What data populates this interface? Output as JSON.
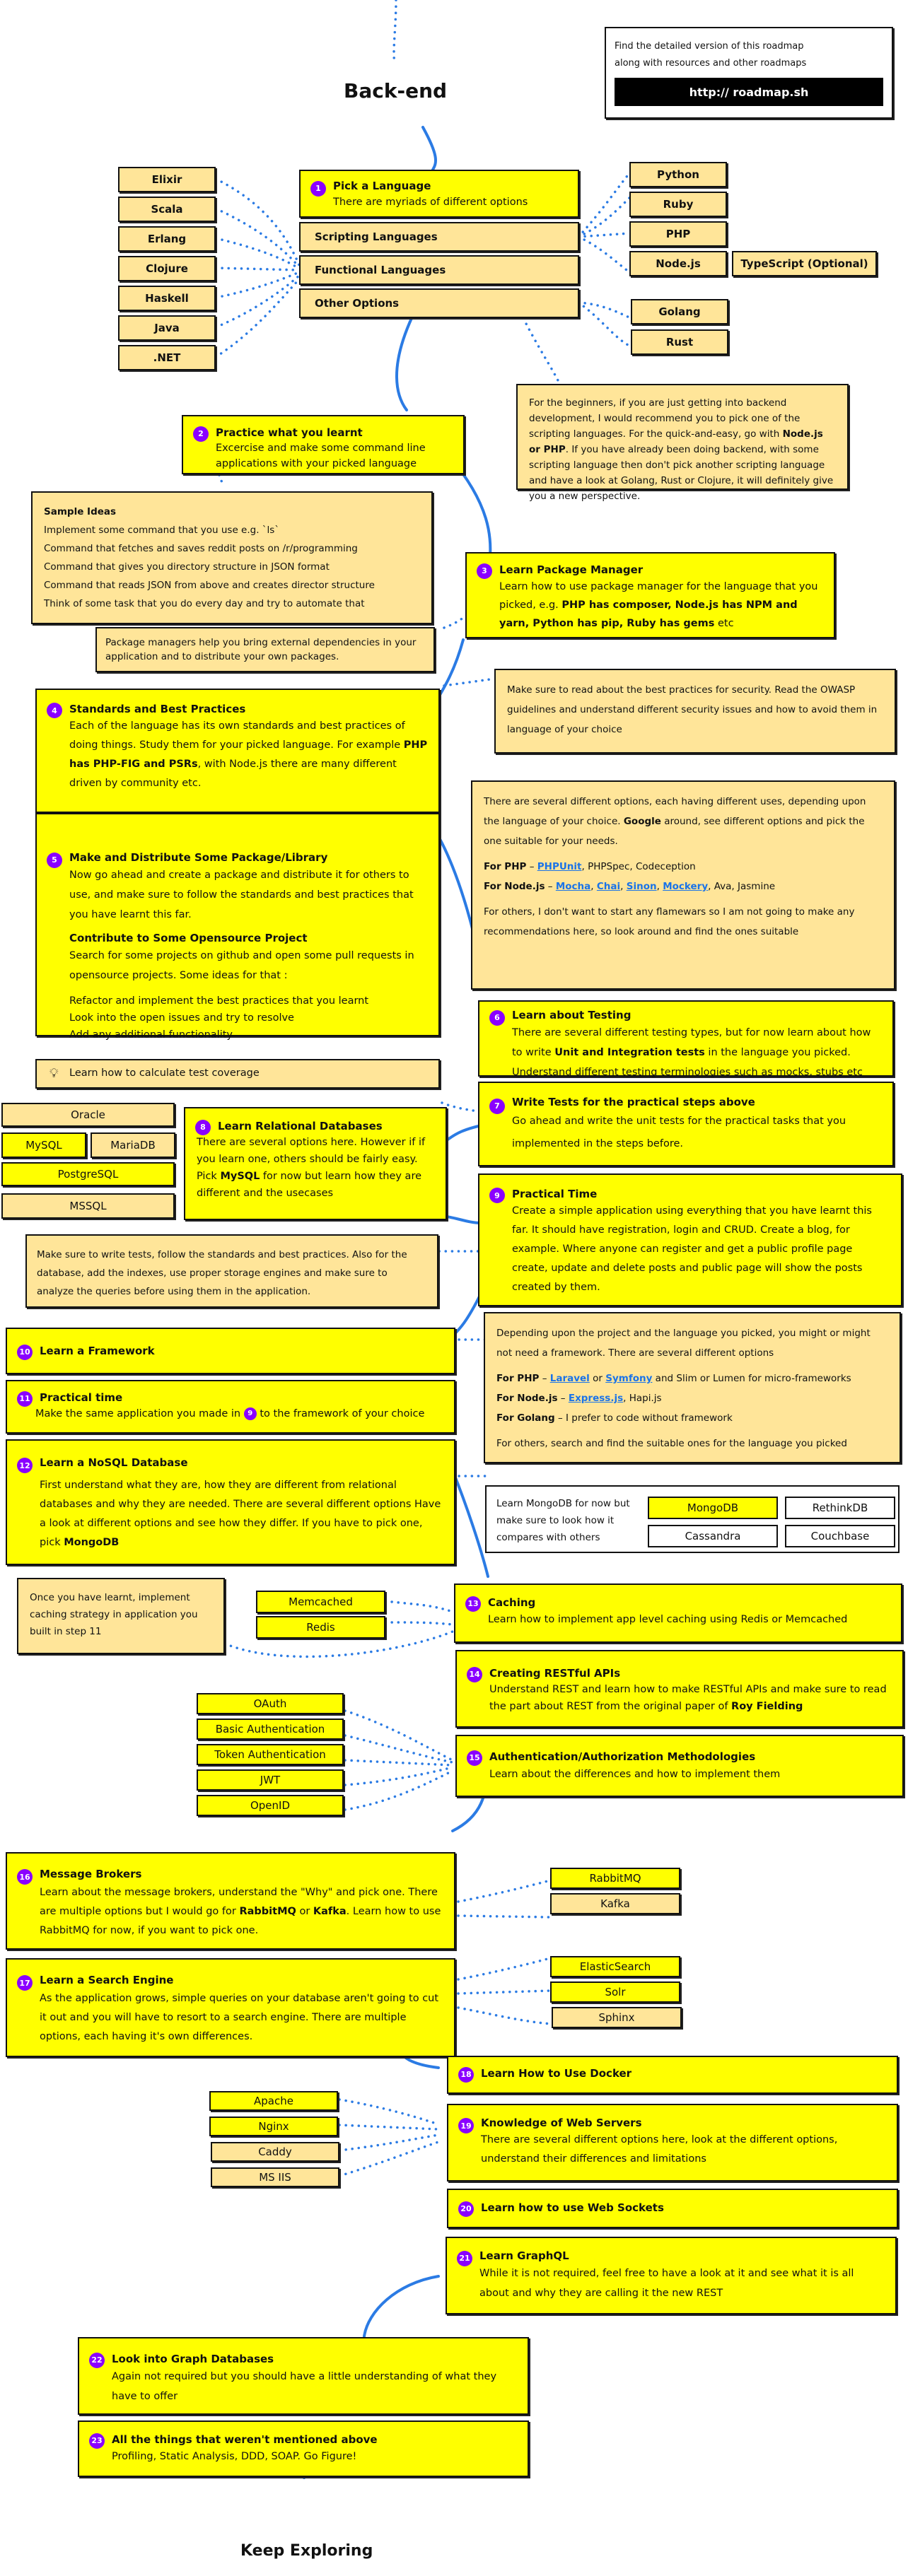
{
  "title": "Back-end",
  "footer_title": "Keep Exploring",
  "info_box": {
    "text_line1": "Find the detailed version of this roadmap",
    "text_line2": "along with resources and other roadmaps",
    "link_label": "http:// roadmap.sh"
  },
  "colors": {
    "primary": "#ffff00",
    "secondary": "#ffe599",
    "connector": "#2b7be4",
    "badge": "#8a00ff"
  },
  "step1": {
    "num": "1",
    "title": "Pick a Language",
    "desc": "There are myriads of different options",
    "categories": [
      "Scripting Languages",
      "Functional Languages",
      "Other Options"
    ],
    "functional": [
      "Elixir",
      "Scala",
      "Erlang",
      "Clojure",
      "Haskell",
      "Java",
      ".NET"
    ],
    "scripting": [
      "Python",
      "Ruby",
      "PHP",
      "Node.js"
    ],
    "scripting_extra": "TypeScript (Optional)",
    "other": [
      "Golang",
      "Rust"
    ],
    "note": {
      "p1": "For the beginners, if you are just getting into backend development, I would recommend you to pick one of the scripting languages. For the quick-and-easy, go with ",
      "b1": "Node.js or PHP",
      "p2": ". If you have already been doing backend, with some scripting language then don't pick another scripting language and have a look at Golang, Rust or Clojure, it will definitely give you a new perspective."
    }
  },
  "step2": {
    "num": "2",
    "title": "Practice what you learnt",
    "desc": "Excercise and make some command line applications with your picked language",
    "ideas_title": "Sample Ideas",
    "ideas": [
      "Implement some command that you use e.g. `ls`",
      "Command that fetches and saves reddit posts on /r/programming",
      "Command that gives you directory structure in JSON format",
      "Command that reads JSON from above and creates director structure",
      "Think of some task that you do every day and try to automate that"
    ]
  },
  "step3": {
    "num": "3",
    "title": "Learn Package Manager",
    "p1": "Learn how to use package manager for the language that you picked, e.g. ",
    "b1": "PHP has composer, Node.js has NPM and yarn, Python has pip, Ruby has gems",
    "p2": " etc",
    "note": "Package managers help you bring external dependencies in your application and to distribute your own packages."
  },
  "step4": {
    "num": "4",
    "title": "Standards and Best Practices",
    "p1": "Each of the language has its own standards and best practices of doing things. Study them for your picked language. For example ",
    "b1": "PHP has PHP-FIG and PSRs",
    "p2": ", with Node.js there are many different driven by community etc.",
    "note": "Make sure to read about the best practices for security. Read the OWASP guidelines and understand different security issues and how to avoid them in language of your choice"
  },
  "step5": {
    "num": "5",
    "title": "Make and Distribute Some Package/Library",
    "desc": "Now go ahead and create a package and distribute it for others to use, and make sure to follow the standards and best practices that you have learnt this far.",
    "sub_title": "Contribute to Some Opensource Project",
    "sub_desc": "Search for some projects on github and open some pull requests in opensource projects. Some ideas for that :",
    "ideas": [
      "Refactor and implement the best practices that you learnt",
      "Look into the open issues and try to resolve",
      "Add any additional functionality"
    ]
  },
  "testing_note": {
    "p1": "There are several different options, each having different uses, depending upon the language of your choice. ",
    "b1": "Google",
    "p2": " around, see different options and pick the one suitable for your needs.",
    "php_label": "For PHP",
    "php_links": [
      "PHPUnit"
    ],
    "php_rest": ", PHPSpec, Codeception",
    "node_label": "For Node.js",
    "node_links": [
      "Mocha",
      "Chai",
      "Sinon",
      "Mockery"
    ],
    "node_rest": ", Ava, Jasmine",
    "others": "For others, I don't want to start any flamewars so I am not going to make any recommendations here, so look around and find the ones suitable"
  },
  "step6": {
    "num": "6",
    "title": "Learn about Testing",
    "p1": "There are several different testing types, but for now learn about how to write ",
    "b1": "Unit and Integration tests",
    "p2": " in the language you picked. Understand different testing terminologies such as mocks, stubs etc"
  },
  "coverage_tip": "Learn how to calculate test coverage",
  "step7": {
    "num": "7",
    "title": "Write Tests for the practical steps above",
    "desc": "Go ahead and write the unit tests for the practical tasks that you implemented in the steps before."
  },
  "step8": {
    "num": "8",
    "title": "Learn Relational Databases",
    "p1": "There are several options here. However if if you learn one, others should be fairly easy. Pick ",
    "b1": "MySQL",
    "p2": " for now but learn how they are different and the usecases",
    "databases": {
      "oracle": "Oracle",
      "mysql": "MySQL",
      "mariadb": "MariaDB",
      "postgresql": "PostgreSQL",
      "mssql": "MSSQL"
    },
    "note": "Make sure to write tests, follow the standards and best practices. Also for the database, add the indexes, use proper storage engines and make sure to analyze the queries before using them in the application."
  },
  "step9": {
    "num": "9",
    "title": "Practical Time",
    "desc": "Create a simple application using everything that you have learnt this far. It should have registration, login and CRUD. Create a blog, for example. Where anyone can register and get a public profile page create, update and delete posts and public page will show the posts created by them."
  },
  "step10": {
    "num": "10",
    "title": "Learn a Framework",
    "note": {
      "intro": "Depending upon the project and the language you picked, you might or might not need a framework. There are several different options",
      "php_label": "For PHP",
      "php_link1": "Laravel",
      "php_mid": " or ",
      "php_link2": "Symfony",
      "php_rest": " and Slim or Lumen for micro-frameworks",
      "node_label": "For Node.js",
      "node_link": "Express.js",
      "node_rest": ", Hapi.js",
      "go_label": "For Golang",
      "go_rest": " I prefer to code without framework",
      "others": "For others, search and find the suitable ones for the language you picked"
    }
  },
  "step11": {
    "num": "11",
    "title": "Practical time",
    "desc_a": "Make the same application you made in ",
    "ref": "9",
    "desc_b": " to the framework of your choice"
  },
  "step12": {
    "num": "12",
    "title": "Learn a NoSQL Database",
    "p1": "First understand what they are, how they are different from relational databases and why they are needed. There are several different options Have a look at different options and see how they differ. If you have to pick one, pick ",
    "b1": "MongoDB",
    "aside": "Learn MongoDB for now but make sure to look how it compares with others",
    "options": [
      "MongoDB",
      "RethinkDB",
      "Cassandra",
      "Couchbase"
    ]
  },
  "step13": {
    "num": "13",
    "title": "Caching",
    "desc": "Learn how to implement app level caching using Redis or Memcached",
    "options": [
      "Memcached",
      "Redis"
    ],
    "note": "Once you have learnt, implement caching strategy in application you built in step 11"
  },
  "step14": {
    "num": "14",
    "title": "Creating RESTful APIs",
    "p1": "Understand REST and learn how to make RESTful APIs and make sure to read the part about REST from the original paper of ",
    "b1": "Roy Fielding"
  },
  "step15": {
    "num": "15",
    "title": "Authentication/Authorization Methodologies",
    "desc": "Learn about the differences and how to implement them",
    "options": [
      "OAuth",
      "Basic Authentication",
      "Token Authentication",
      "JWT",
      "OpenID"
    ]
  },
  "step16": {
    "num": "16",
    "title": "Message Brokers",
    "p1": "Learn about the message brokers, understand the \"Why\" and pick one. There are multiple options but I would go for ",
    "b1": "RabbitMQ",
    "mid": " or ",
    "b2": "Kafka",
    "p2": ". Learn how to use RabbitMQ for now, if you want to pick one.",
    "options": [
      "RabbitMQ",
      "Kafka"
    ]
  },
  "step17": {
    "num": "17",
    "title": "Learn a Search Engine",
    "desc": "As the application grows, simple queries on your database aren't going to cut it out and you will have to resort to a search engine. There are multiple options, each having it's own differences.",
    "options": [
      "ElasticSearch",
      "Solr",
      "Sphinx"
    ]
  },
  "step18": {
    "num": "18",
    "title": "Learn How to Use Docker"
  },
  "step19": {
    "num": "19",
    "title": "Knowledge of Web Servers",
    "desc": "There are several different options here, look at the different options, understand their differences and limitations",
    "options": [
      "Apache",
      "Nginx",
      "Caddy",
      "MS IIS"
    ]
  },
  "step20": {
    "num": "20",
    "title": "Learn how to use Web Sockets"
  },
  "step21": {
    "num": "21",
    "title": "Learn GraphQL",
    "desc": "While it is not required, feel free to have a look at it and see what it is all about and why they are calling it the new REST"
  },
  "step22": {
    "num": "22",
    "title": "Look into Graph Databases",
    "desc": "Again not required but you should have a little understanding of what they have to offer"
  },
  "step23": {
    "num": "23",
    "title": "All the things that weren't mentioned above",
    "desc": "Profiling, Static Analysis, DDD, SOAP. Go Figure!"
  }
}
